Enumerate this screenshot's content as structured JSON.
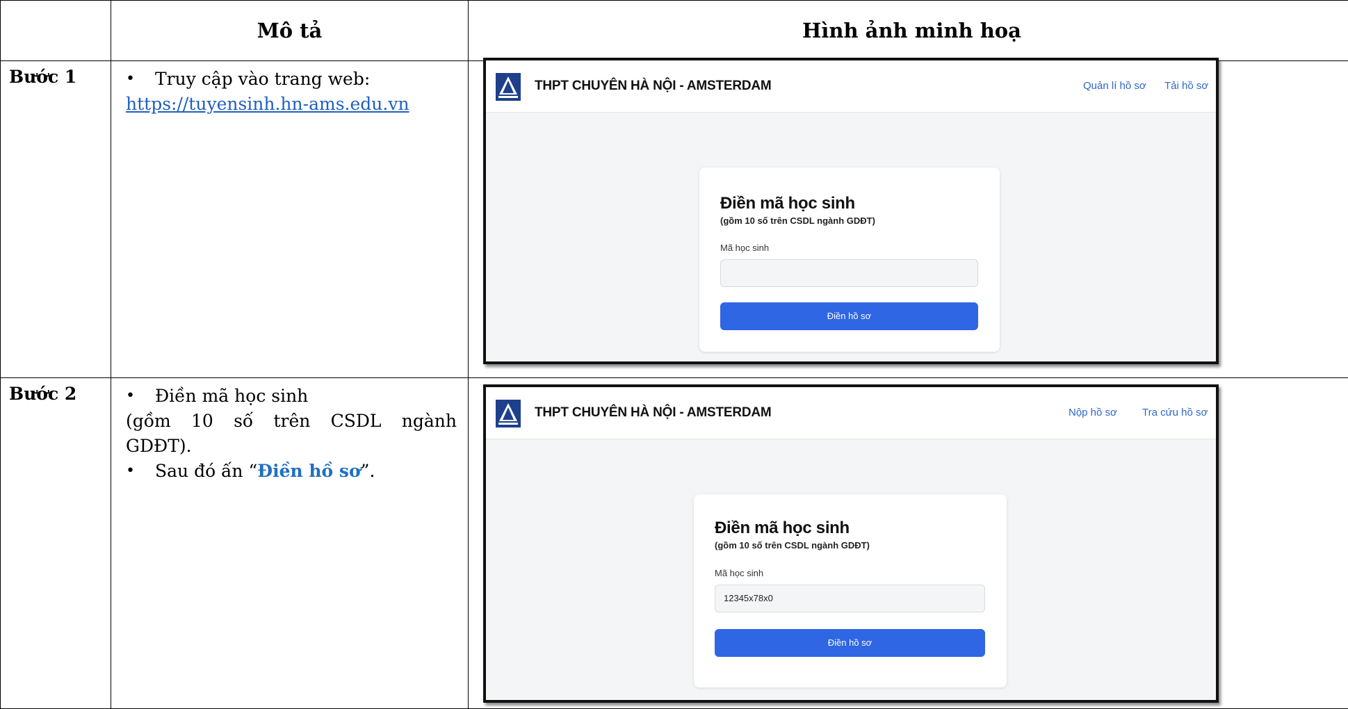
{
  "header": {
    "col_description": "Mô tả",
    "col_illustration": "Hình ảnh minh hoạ"
  },
  "rows": [
    {
      "step": "Bước 1",
      "text1": "Truy cập vào trang web:",
      "link": "https://tuyensinh.hn-ams.edu.vn"
    },
    {
      "step": "Bước 2",
      "bullet1": "Điền mã học sinh",
      "cont_a": "(gồm 10 số trên CSDL ngành",
      "cont_b": "GDĐT).",
      "bullet2_prefix": "Sau đó ấn “",
      "bullet2_highlight": "Điền hồ sơ",
      "bullet2_suffix": "”."
    }
  ],
  "shot1": {
    "brand": "THPT CHUYÊN HÀ NỘI - AMSTERDAM",
    "nav1": "Quản lí hồ sơ",
    "nav2": "Tải hồ sơ",
    "title": "Điền mã học sinh",
    "subtitle": "(gồm 10 số trên CSDL ngành GDĐT)",
    "label": "Mã học sinh",
    "input_value": "",
    "button": "Điền hồ sơ"
  },
  "shot2": {
    "brand": "THPT CHUYÊN HÀ NỘI - AMSTERDAM",
    "nav1": "Nộp hồ sơ",
    "nav2": "Tra cứu hồ sơ",
    "title": "Điền mã học sinh",
    "subtitle": "(gồm 10 số trên CSDL ngành GDĐT)",
    "label": "Mã học sinh",
    "input_value": "12345x78x0",
    "button": "Điền hồ sơ"
  },
  "colors": {
    "link": "#1f5fbf",
    "highlight": "#1f6fc4",
    "button": "#2f66e4",
    "nav": "#2f66c9"
  }
}
